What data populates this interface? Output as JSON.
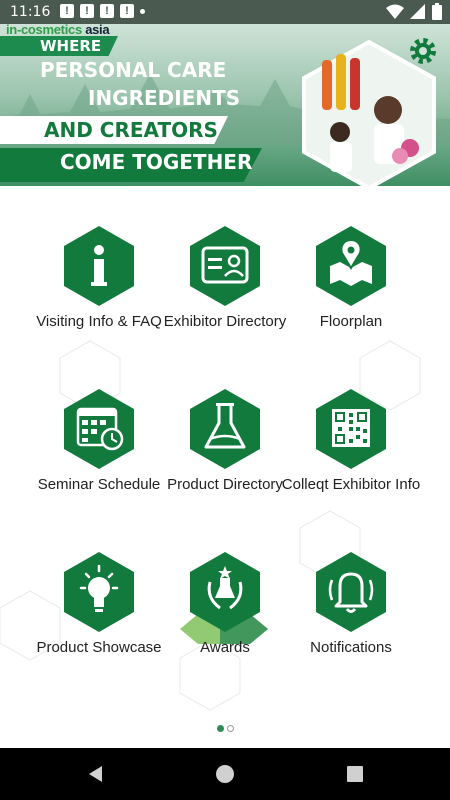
{
  "status_bar": {
    "time": "11:16",
    "notifications": [
      "!",
      "!",
      "!",
      "!"
    ]
  },
  "banner": {
    "brand_main": "in-cosmetics",
    "brand_suffix": "asia",
    "line1": "WHERE",
    "line2": "PERSONAL CARE",
    "line3": "INGREDIENTS",
    "line4": "AND CREATORS",
    "line5": "COME TOGETHER"
  },
  "menu": [
    {
      "label": "Visiting Info & FAQ",
      "icon": "info-icon"
    },
    {
      "label": "Exhibitor Directory",
      "icon": "id-card-icon"
    },
    {
      "label": "Floorplan",
      "icon": "map-pin-icon"
    },
    {
      "label": "Seminar Schedule",
      "icon": "calendar-icon"
    },
    {
      "label": "Product Directory",
      "icon": "flask-icon"
    },
    {
      "label": "Colleqt Exhibitor Info",
      "icon": "qr-code-icon"
    },
    {
      "label": "Product Showcase",
      "icon": "lightbulb-icon"
    },
    {
      "label": "Awards",
      "icon": "award-icon"
    },
    {
      "label": "Notifications",
      "icon": "bell-icon"
    }
  ],
  "pager": {
    "pages": 2,
    "current": 1
  },
  "colors": {
    "brand_green": "#137a3e",
    "status_bar": "#4a5a50"
  }
}
